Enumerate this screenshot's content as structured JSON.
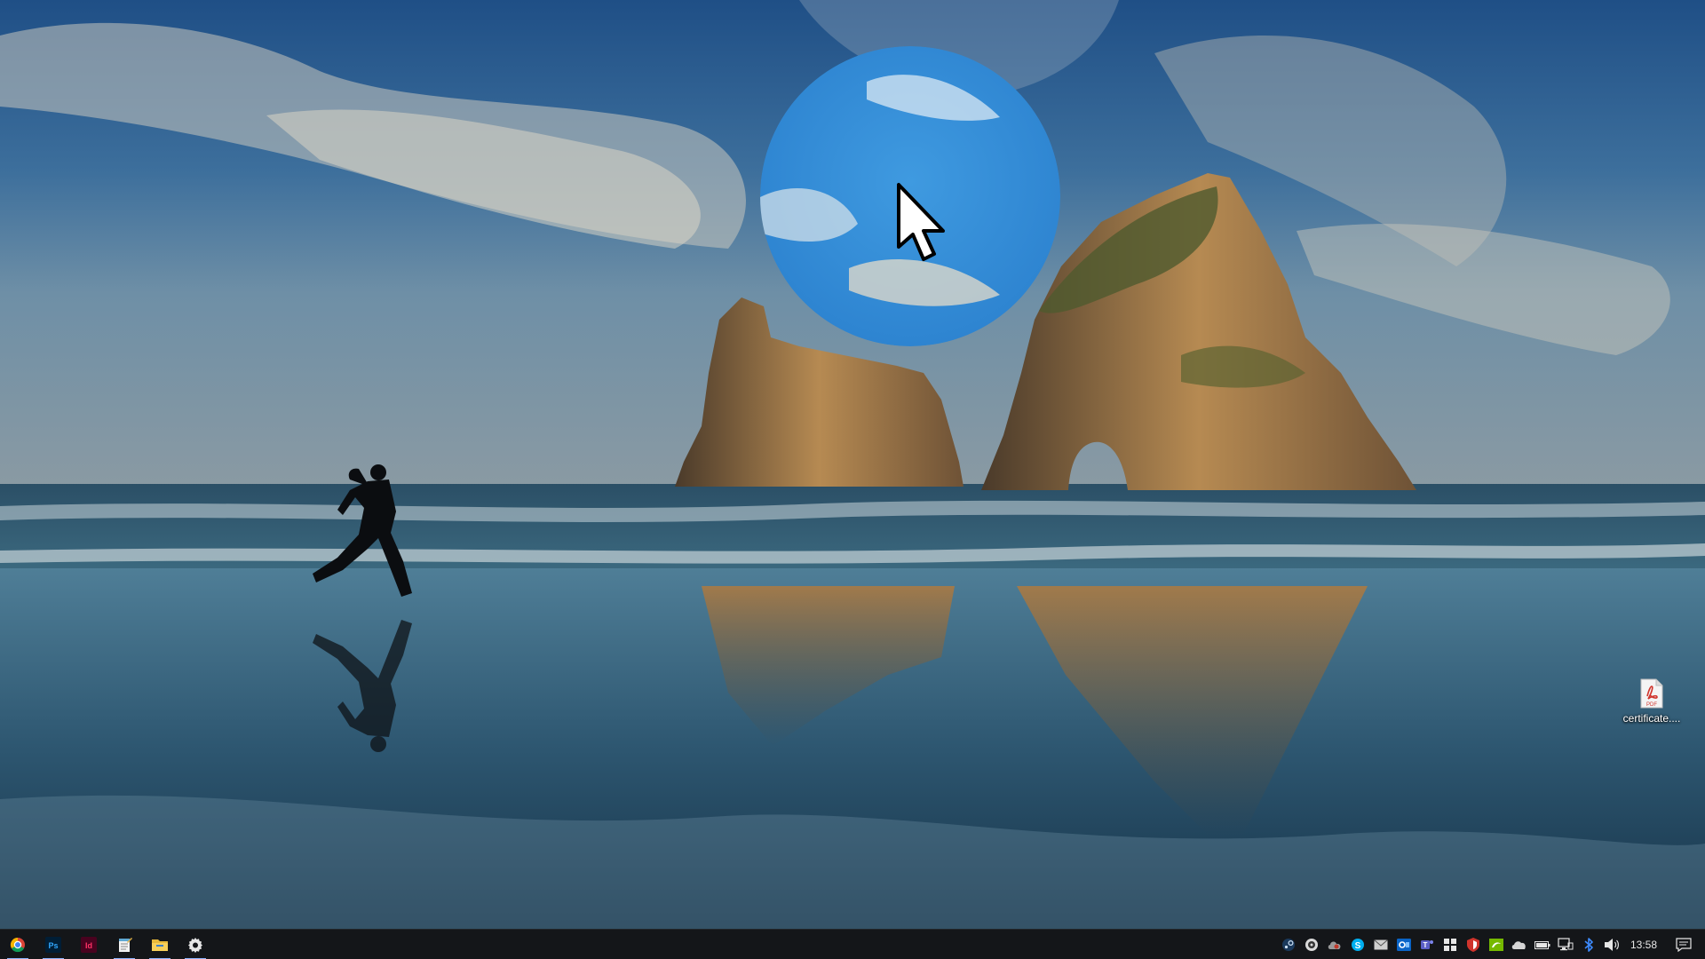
{
  "desktop": {
    "wallpaper": "beach-runner-rocks",
    "icons": [
      {
        "label": "certificate....",
        "icon": "pdf-file-icon",
        "badge": "PDF"
      }
    ]
  },
  "cursor": {
    "icon": "arrow-pointer-icon",
    "highlight": "circular-spotlight"
  },
  "taskbar": {
    "apps": [
      {
        "name": "Google Chrome",
        "icon": "chrome-icon",
        "running": true,
        "glyph": ""
      },
      {
        "name": "Photoshop",
        "icon": "photoshop-icon",
        "running": true,
        "glyph": "Ps"
      },
      {
        "name": "InDesign",
        "icon": "indesign-icon",
        "running": false,
        "glyph": "Id"
      },
      {
        "name": "Notepad",
        "icon": "notepad-icon",
        "running": true,
        "glyph": ""
      },
      {
        "name": "File Explorer",
        "icon": "folder-icon",
        "running": true,
        "glyph": ""
      },
      {
        "name": "Settings",
        "icon": "gear-icon",
        "running": true,
        "glyph": ""
      }
    ],
    "tray": [
      "steam-icon",
      "obs-icon",
      "cloud-sync-icon",
      "skype-icon",
      "mail-icon",
      "outlook-icon",
      "teams-icon",
      "security-shield-icon",
      "antivirus-icon",
      "nvidia-icon",
      "onedrive-icon",
      "battery-icon",
      "network-icon",
      "bluetooth-icon",
      "volume-icon"
    ],
    "clock": "13:58",
    "notification_icon": "action-center-icon"
  },
  "colors": {
    "taskbar_bg": "#141619",
    "active_indicator": "#8cb4ff",
    "photoshop": "#31a8ff",
    "indesign": "#ff3366",
    "pdf_red": "#d0342c"
  }
}
